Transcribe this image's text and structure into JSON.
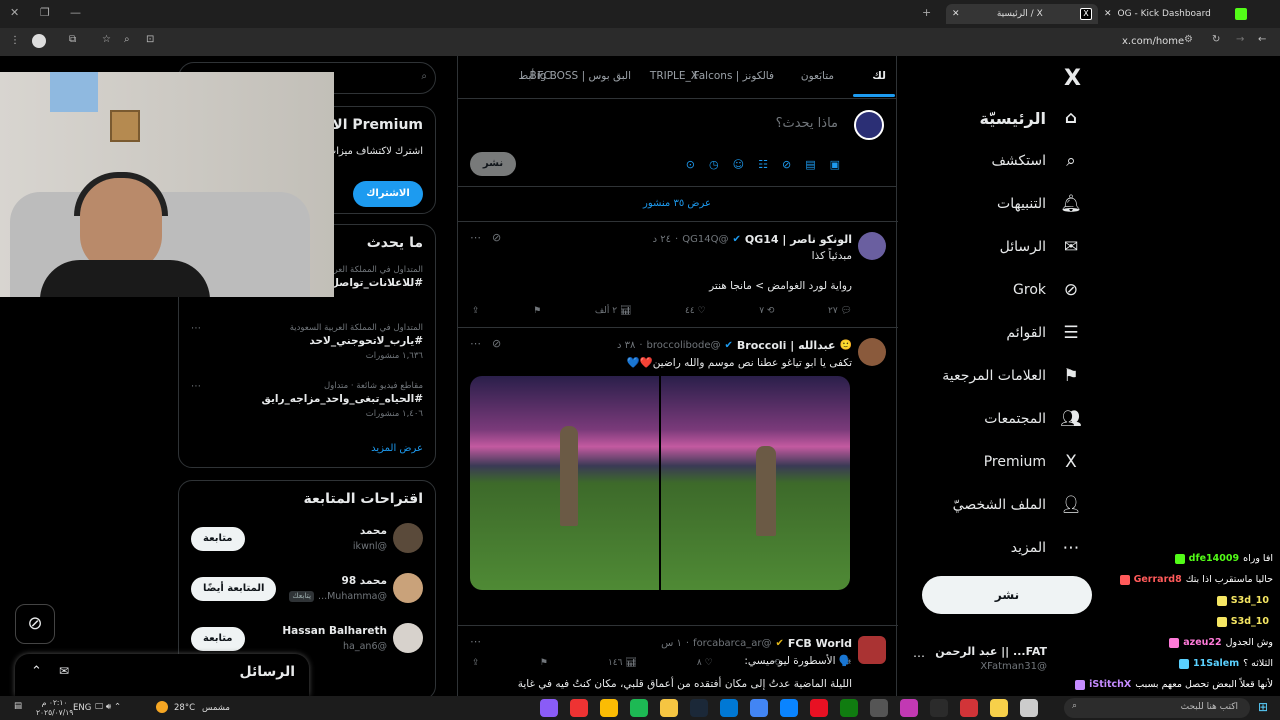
{
  "browser": {
    "tabs": [
      {
        "title": "الرئيسية / X",
        "active": true
      },
      {
        "title": "OG - Kick Dashboard",
        "active": false
      }
    ],
    "url": "x.com/home"
  },
  "nav": {
    "items": [
      {
        "label": "الرئيسيّة",
        "icon": "home-icon",
        "glyph": "⌂",
        "active": true
      },
      {
        "label": "استكشف",
        "icon": "search-icon",
        "glyph": "⌕"
      },
      {
        "label": "التنبيهات",
        "icon": "bell-icon",
        "glyph": "🔔︎"
      },
      {
        "label": "الرسائل",
        "icon": "mail-icon",
        "glyph": "✉"
      },
      {
        "label": "Grok",
        "icon": "grok-icon",
        "glyph": "⊘"
      },
      {
        "label": "القوائم",
        "icon": "list-icon",
        "glyph": "☰"
      },
      {
        "label": "العلامات المرجعية",
        "icon": "bookmark-icon",
        "glyph": "⚑"
      },
      {
        "label": "المجتمعات",
        "icon": "communities-icon",
        "glyph": "👥︎"
      },
      {
        "label": "Premium",
        "icon": "x-icon",
        "glyph": "X"
      },
      {
        "label": "الملف الشخصيّ",
        "icon": "profile-icon",
        "glyph": "👤︎"
      },
      {
        "label": "المزيد",
        "icon": "more-icon",
        "glyph": "⋯"
      }
    ],
    "post_button": "نشر",
    "account": {
      "name": "FAT... || عبد الرحمن",
      "handle": "@XFatman31"
    }
  },
  "feed": {
    "tabs": [
      "لك",
      "متابَعون",
      "فالكونز | Falcons",
      "TRIPLE_X",
      "البق بوس | Big BOSS",
      "FC أبط"
    ],
    "compose_placeholder": "ماذا يحدث؟",
    "compose_button": "نشر",
    "show_posts": "عرض ٣٥ منشور",
    "tweets": [
      {
        "name": "الونكو ناصر | QG14",
        "handle": "@QG14Q",
        "time": "٢٤ د",
        "text": "مبدئياً كذا",
        "text2": "رواية لورد الغوامض > مانجا هنتر",
        "replies": "٢٧",
        "reposts": "٧",
        "likes": "٤٤",
        "views": "٢ ألف"
      },
      {
        "name": "عبدالله | Broccoli",
        "handle": "@broccolibode",
        "time": "٣٨ د",
        "text": "تكفى يا ابو تياغو عطنا نص موسم والله راضين❤️💙",
        "replies": "",
        "reposts": "",
        "likes": "٨",
        "views": "١٤٦"
      },
      {
        "name": "FCB World",
        "handle": "@forcabarca_ar",
        "time": "١ س",
        "text": "🗣️ الأسطورة ليو ميسي:",
        "text2": "الليلة الماضية عدتُ إلى مكان أفتقده من أعماق قلبي، مكان كنتُ فيه في غاية"
      }
    ]
  },
  "right": {
    "search_placeholder": "بحث",
    "premium": {
      "title": "Premium الاشتراك في",
      "desc": "اشترك لاكتشاف ميزات جديدة وإذا كنت مؤهلاً.",
      "button": "الاشتراك"
    },
    "trends_title": "ما يحدث",
    "trends": [
      {
        "context": "المتداول في المملكة العربية السعودية",
        "name": "#للاعلانات_تواصل_",
        "count": ""
      },
      {
        "context": "المتداول في المملكة العربية السعودية",
        "name": "#يارب_لاتحوجني_لاحد",
        "count": "١,٦٣٦ منشورات"
      },
      {
        "context": "مقاطع فيديو شائعة · متداول",
        "name": "#الحياه_تبغى_واحد_مزاجه_رايق",
        "count": "١,٤٠٦ منشورات"
      }
    ],
    "show_more": "عرض المزيد",
    "follow_title": "اقتراحات المتابعة",
    "follows": [
      {
        "name": "محمد",
        "handle": "@ikwnl",
        "button": "متابعة",
        "follows_you": ""
      },
      {
        "name": "محمد 98",
        "handle": "@Muhamma...",
        "button": "المتابعة أيضًا",
        "follows_you": "يتابعك"
      },
      {
        "name": "Hassan Balhareth",
        "handle": "@ha_an6",
        "button": "متابعة",
        "follows_you": ""
      }
    ],
    "messages_title": "الرسائل"
  },
  "chat": [
    {
      "user": "dfe14009",
      "text": "افا وراه",
      "color": "#53fc18"
    },
    {
      "user": "Gerrard8",
      "text": "حاليا ماستقرب اذا بتك",
      "color": "#ff5a5a"
    },
    {
      "user": "S3d_10",
      "text": "",
      "color": "#f5e663"
    },
    {
      "user": "S3d_10",
      "text": "",
      "color": "#f5e663"
    },
    {
      "user": "azeu22",
      "text": "وش الجدول",
      "color": "#ff7ad9"
    },
    {
      "user": "11Salem",
      "text": "الثلاثه ؟",
      "color": "#5ad1ff"
    },
    {
      "user": "iStitchX",
      "text": "لأنها قعلاً البعض تحصل معهم بسبب",
      "color": "#c58bff"
    }
  ],
  "taskbar": {
    "weather": "مشمس",
    "temp": "28°C",
    "lang": "ENG",
    "time": "٠٢:١٠ م",
    "date": "٢٠٢٥/٠٧/١٩",
    "search": "اكتب هنا للبحث"
  },
  "colors": {
    "accent": "#1d9bf0",
    "bg": "#000000",
    "border": "#2f3336"
  }
}
